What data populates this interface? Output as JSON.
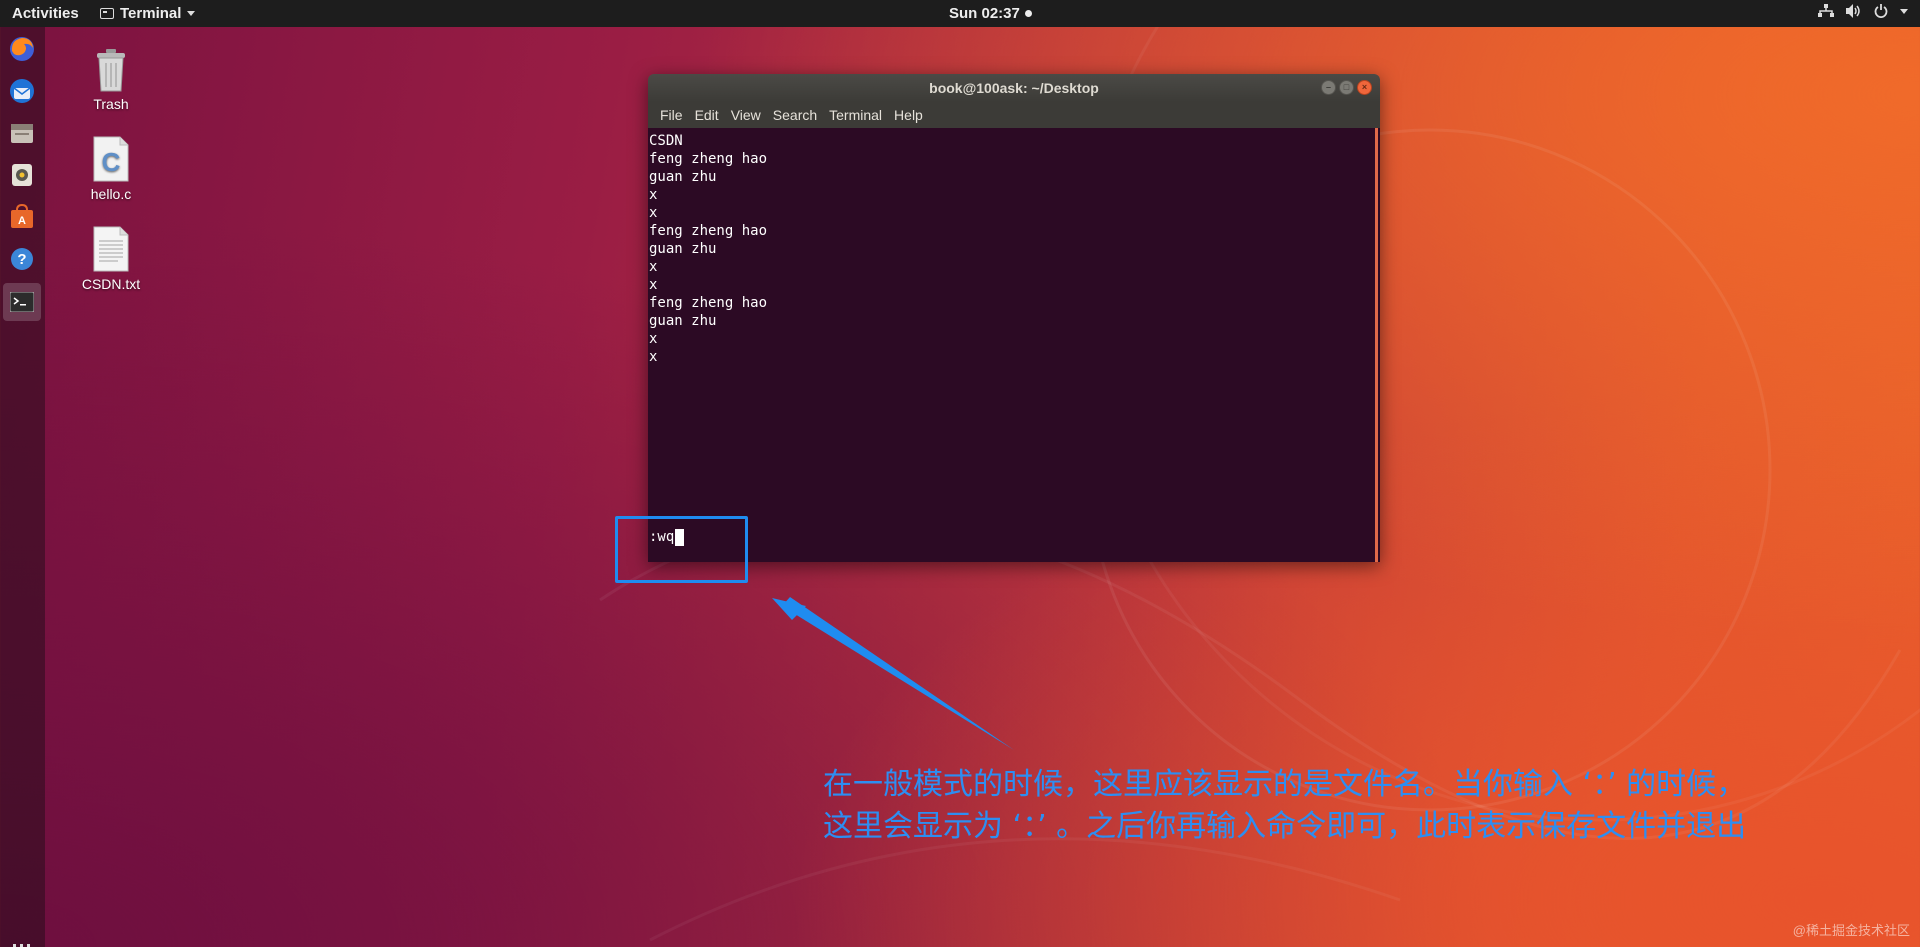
{
  "topbar": {
    "activities_label": "Activities",
    "app_menu_label": "Terminal",
    "clock": "Sun 02:37"
  },
  "dock": {
    "items": [
      {
        "name": "firefox-icon"
      },
      {
        "name": "thunderbird-icon"
      },
      {
        "name": "files-icon"
      },
      {
        "name": "rhythmbox-icon"
      },
      {
        "name": "software-center-icon"
      },
      {
        "name": "help-icon"
      },
      {
        "name": "terminal-icon"
      }
    ],
    "show_apps_icon": "grid-icon"
  },
  "desktop": {
    "icons": [
      {
        "label": "Trash"
      },
      {
        "label": "hello.c"
      },
      {
        "label": "CSDN.txt"
      }
    ]
  },
  "terminal": {
    "title": "book@100ask: ~/Desktop",
    "menu": [
      "File",
      "Edit",
      "View",
      "Search",
      "Terminal",
      "Help"
    ],
    "lines": "CSDN\nfeng zheng hao\nguan zhu\nx\nx\nfeng zheng hao\nguan zhu\nx\nx\nfeng zheng hao\nguan zhu\nx\nx",
    "command_line": ":wq"
  },
  "annotation": {
    "line1": "在一般模式的时候，这里应该显示的是文件名。当你输入 ‘：’ 的时候，",
    "line2": "这里会显示为 ‘：’ 。之后你再输入命令即可，此时表示保存文件并退出",
    "accent_color": "#2d8ef2"
  },
  "watermark": "@稀土掘金技术社区"
}
